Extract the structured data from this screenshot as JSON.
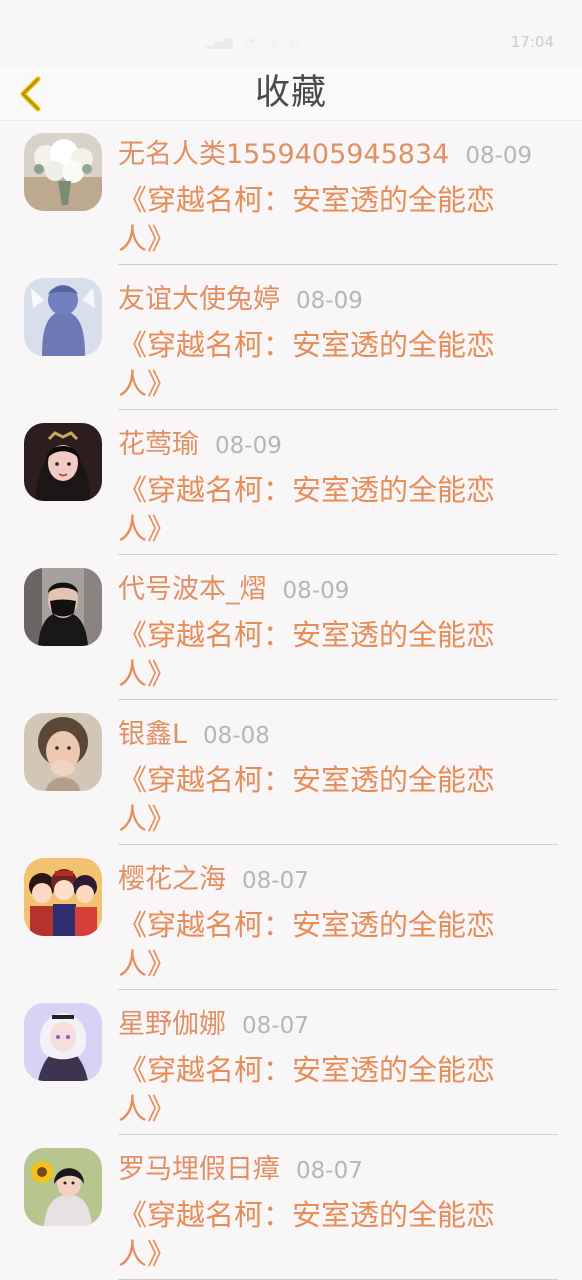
{
  "status_bar": {
    "time": "17:04",
    "icons": [
      "signal-icon",
      "wifi-icon",
      "battery-icon",
      "alarm-icon"
    ]
  },
  "header": {
    "title": "收藏",
    "back_icon": "chevron-left-icon",
    "accent_color": "#e6b800"
  },
  "items": [
    {
      "username": "无名人类1559405945834",
      "date": "08-09",
      "title": "《穿越名柯：安室透的全能恋人》",
      "avatar": "flowers-avatar"
    },
    {
      "username": "友谊大使兔婷",
      "date": "08-09",
      "title": "《穿越名柯：安室透的全能恋人》",
      "avatar": "blue-anime-avatar"
    },
    {
      "username": "花莺瑜",
      "date": "08-09",
      "title": "《穿越名柯：安室透的全能恋人》",
      "avatar": "costume-woman-avatar"
    },
    {
      "username": "代号波本_熠",
      "date": "08-09",
      "title": "《穿越名柯：安室透的全能恋人》",
      "avatar": "masked-man-avatar"
    },
    {
      "username": "银鑫L",
      "date": "08-08",
      "title": "《穿越名柯：安室透的全能恋人》",
      "avatar": "child-avatar"
    },
    {
      "username": "樱花之海",
      "date": "08-07",
      "title": "《穿越名柯：安室透的全能恋人》",
      "avatar": "cartoon-group-avatar"
    },
    {
      "username": "星野伽娜",
      "date": "08-07",
      "title": "《穿越名柯：安室透的全能恋人》",
      "avatar": "anime-girl-avatar"
    },
    {
      "username": "罗马埋假日瘴",
      "date": "08-07",
      "title": "《穿越名柯：安室透的全能恋人》",
      "avatar": "sunflower-girl-avatar"
    }
  ],
  "colors": {
    "username": "#e29063",
    "title": "#e88c58",
    "date": "#b8b6b5",
    "background": "#f8f6f7"
  }
}
